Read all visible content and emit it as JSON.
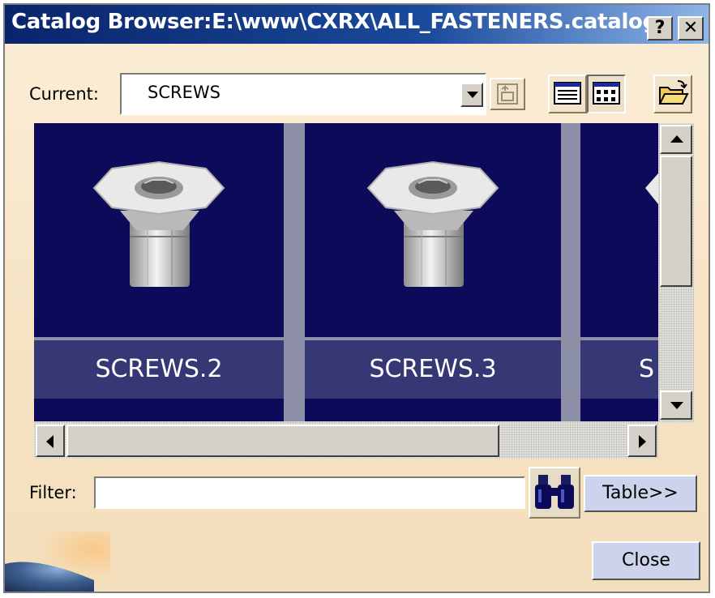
{
  "window": {
    "title": "Catalog Browser:E:\\www\\CXRX\\ALL_FASTENERS.catalog",
    "help_label": "?",
    "close_label": "✕"
  },
  "current": {
    "label": "Current:",
    "value": "SCREWS"
  },
  "toolbar": {
    "icons": [
      "parent-level-icon",
      "details-view-icon",
      "icon-view-icon",
      "open-folder-icon"
    ]
  },
  "items": [
    {
      "label": "SCREWS.2"
    },
    {
      "label": "SCREWS.3"
    },
    {
      "label": "S"
    }
  ],
  "filter": {
    "label": "Filter:",
    "value": "",
    "search_icon": "binoculars-icon"
  },
  "buttons": {
    "table_label": "Table>>",
    "close_label": "Close"
  },
  "colors": {
    "title_bar": "#0a246a",
    "dialog_bg": "#f6e3c4",
    "thumbnail_bg": "#0e0a5a",
    "label_band": "#363775"
  }
}
